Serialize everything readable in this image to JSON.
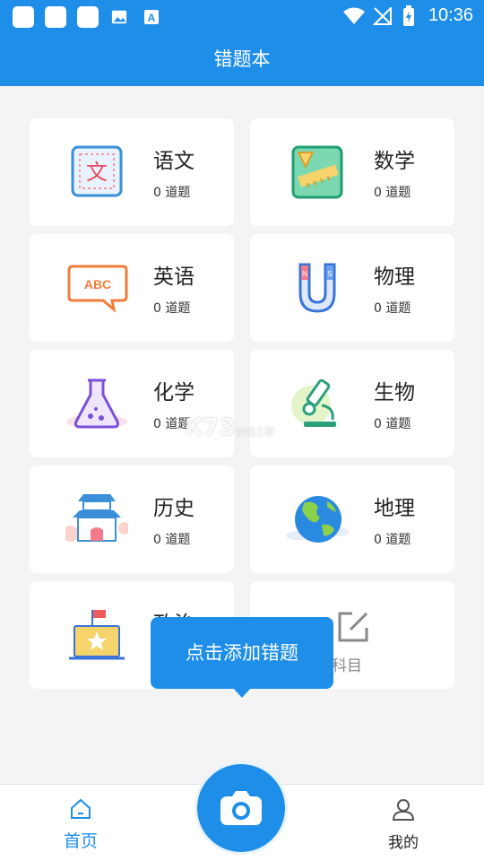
{
  "status_bar": {
    "time": "10:36"
  },
  "header": {
    "title": "错题本"
  },
  "subjects": [
    {
      "name": "语文",
      "count": "0 道题",
      "icon": "chinese-icon"
    },
    {
      "name": "数学",
      "count": "0 道题",
      "icon": "math-icon"
    },
    {
      "name": "英语",
      "count": "0 道题",
      "icon": "english-icon"
    },
    {
      "name": "物理",
      "count": "0 道题",
      "icon": "physics-icon"
    },
    {
      "name": "化学",
      "count": "0 道题",
      "icon": "chemistry-icon"
    },
    {
      "name": "生物",
      "count": "0 道题",
      "icon": "biology-icon"
    },
    {
      "name": "历史",
      "count": "0 道题",
      "icon": "history-icon"
    },
    {
      "name": "地理",
      "count": "0 道题",
      "icon": "geography-icon"
    },
    {
      "name": "政治",
      "count": "",
      "icon": "politics-icon"
    }
  ],
  "edit_card": {
    "label": "辑科目"
  },
  "tooltip": {
    "text": "点击添加错题"
  },
  "watermark": {
    "text": "K73",
    "sub": "游戏之家"
  },
  "bottom_nav": {
    "home_label": "首页",
    "mine_label": "我的"
  },
  "colors": {
    "primary": "#1e8ee9",
    "background": "#f4f4f4"
  }
}
